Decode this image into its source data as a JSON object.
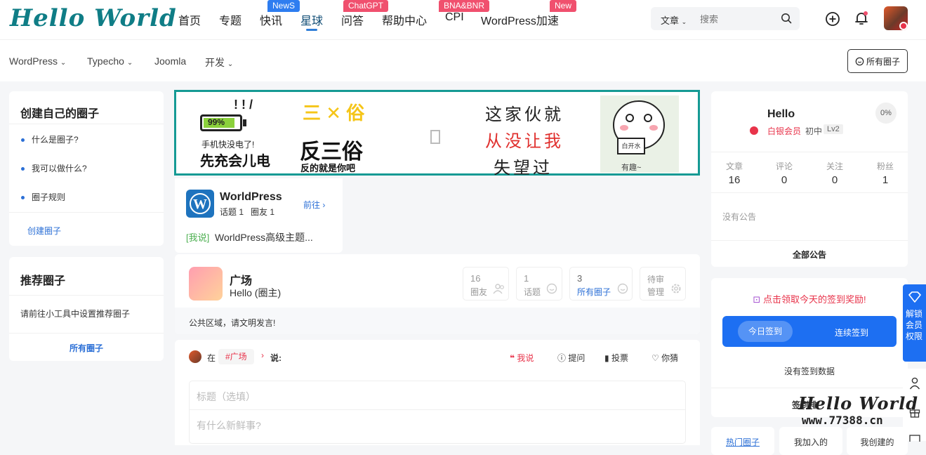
{
  "header": {
    "logo": "Hello World",
    "nav": [
      {
        "label": "首页"
      },
      {
        "label": "专题"
      },
      {
        "label": "快讯",
        "badge": "NewS"
      },
      {
        "label": "星球"
      },
      {
        "label": "问答",
        "badge": "ChatGPT"
      },
      {
        "label": "帮助中心"
      },
      {
        "label": "CPI",
        "badge": "BNA&BNR"
      },
      {
        "label": "WordPress加速",
        "badge": "New"
      }
    ],
    "search": {
      "category": "文章",
      "placeholder": "搜索"
    }
  },
  "subnav": {
    "items": [
      {
        "label": "WordPress"
      },
      {
        "label": "Typecho"
      },
      {
        "label": "Joomla"
      },
      {
        "label": "开发"
      }
    ],
    "all_circles": "所有圈子"
  },
  "left": {
    "create": {
      "title": "创建自己的圈子",
      "items": [
        "什么是圈子?",
        "我可以做什么?",
        "圈子规则"
      ],
      "link": "创建圈子"
    },
    "recommend": {
      "title": "推荐圈子",
      "text": "请前往小工具中设置推荐圈子",
      "link": "所有圈子"
    }
  },
  "banner": {
    "battery": "99%",
    "phone_line1": "手机快没电了!",
    "phone_line2": "先充会儿电",
    "anti_title": "反三俗",
    "anti_sub": "反的就是你吧",
    "poem": [
      "这家伙就",
      "从没让我",
      "失望过"
    ],
    "meme_label": "白开水",
    "meme_caption": "有趣~"
  },
  "circle_card": {
    "name": "WorldPress",
    "topics": "话题 1",
    "members": "圈友 1",
    "go": "前往",
    "tag": "[我说]",
    "post": "WorldPress高级主题..."
  },
  "plaza": {
    "name": "广场",
    "owner": "Hello (圈主)",
    "stats": [
      {
        "value": "16",
        "label": "圈友"
      },
      {
        "value": "1",
        "label": "话题"
      },
      {
        "value": "3",
        "label": "所有圈子"
      },
      {
        "value": "待审",
        "label": "管理"
      }
    ],
    "notice": "公共区域，请文明发言!"
  },
  "compose": {
    "in": "在",
    "tag": "#广场",
    "say": "说:",
    "actions": [
      "我说",
      "提问",
      "投票",
      "你猜"
    ],
    "title_placeholder": "标题（选填）",
    "body_placeholder": "有什么新鲜事?"
  },
  "profile": {
    "name": "Hello",
    "level_name": "白银会员",
    "rank": "初中",
    "lv": "Lv2",
    "progress": "0%",
    "stats": [
      {
        "label": "文章",
        "value": "16"
      },
      {
        "label": "评论",
        "value": "0"
      },
      {
        "label": "关注",
        "value": "0"
      },
      {
        "label": "粉丝",
        "value": "1"
      }
    ],
    "notice": "没有公告",
    "all_notice": "全部公告"
  },
  "checkin": {
    "promo": "点击领取今天的签到奖励!",
    "today": "今日签到",
    "streak": "连续签到",
    "empty": "没有签到数据",
    "partial": "签到排"
  },
  "bottom_tabs": [
    "热门圈子",
    "我加入的",
    "我创建的"
  ],
  "side_float": {
    "unlock": "解锁会员权限"
  },
  "watermark": {
    "title": "Hello World",
    "url": "www.77388.cn"
  },
  "colors": {
    "brand": "#0f7d86",
    "accent": "#2b6fd6",
    "red": "#e8334a"
  }
}
